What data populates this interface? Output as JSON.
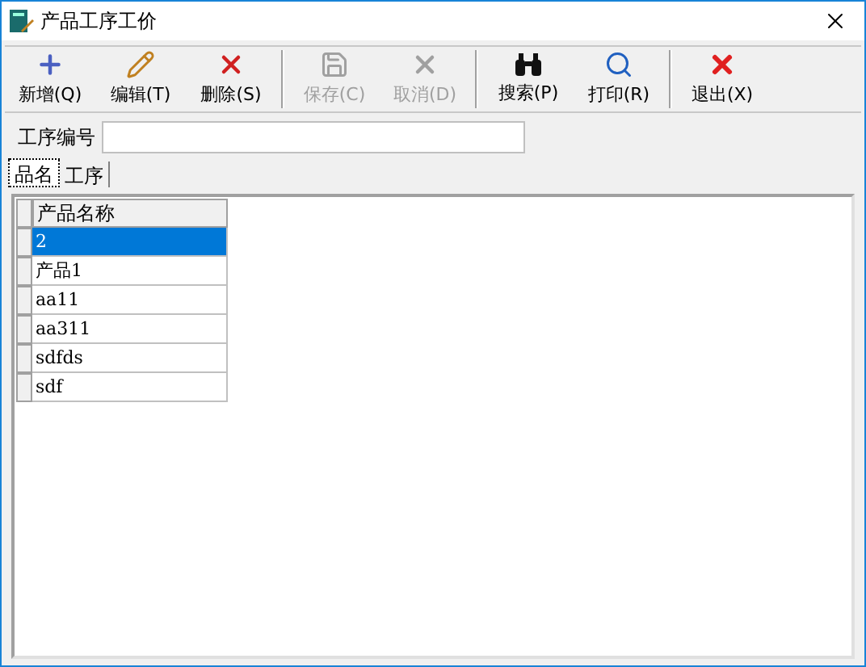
{
  "window": {
    "title": "产品工序工价"
  },
  "toolbar_groups": [
    {
      "buttons": [
        {
          "kind": "new",
          "label": "新增(Q)",
          "disabled": false
        },
        {
          "kind": "edit",
          "label": "编辑(T)",
          "disabled": false
        },
        {
          "kind": "delete",
          "label": "删除(S)",
          "disabled": false
        }
      ]
    },
    {
      "buttons": [
        {
          "kind": "save",
          "label": "保存(C)",
          "disabled": true
        },
        {
          "kind": "cancel",
          "label": "取消(D)",
          "disabled": true
        }
      ]
    },
    {
      "buttons": [
        {
          "kind": "search",
          "label": "搜索(P)",
          "disabled": false
        },
        {
          "kind": "print",
          "label": "打印(R)",
          "disabled": false
        }
      ]
    },
    {
      "buttons": [
        {
          "kind": "exit",
          "label": "退出(X)",
          "disabled": false
        }
      ]
    }
  ],
  "process_field": {
    "label": "工序编号"
  },
  "tabs": [
    {
      "label": "品名",
      "selected": true
    },
    {
      "label": "工序",
      "selected": false
    }
  ],
  "table": {
    "columns": [
      "产品名称"
    ],
    "rows": [
      {
        "cells": [
          "2"
        ],
        "selected": true
      },
      {
        "cells": [
          "产品1"
        ],
        "selected": false
      },
      {
        "cells": [
          "aa11"
        ],
        "selected": false
      },
      {
        "cells": [
          "aa311"
        ],
        "selected": false
      },
      {
        "cells": [
          "sdfds"
        ],
        "selected": false
      },
      {
        "cells": [
          "sdf"
        ],
        "selected": false
      }
    ]
  }
}
